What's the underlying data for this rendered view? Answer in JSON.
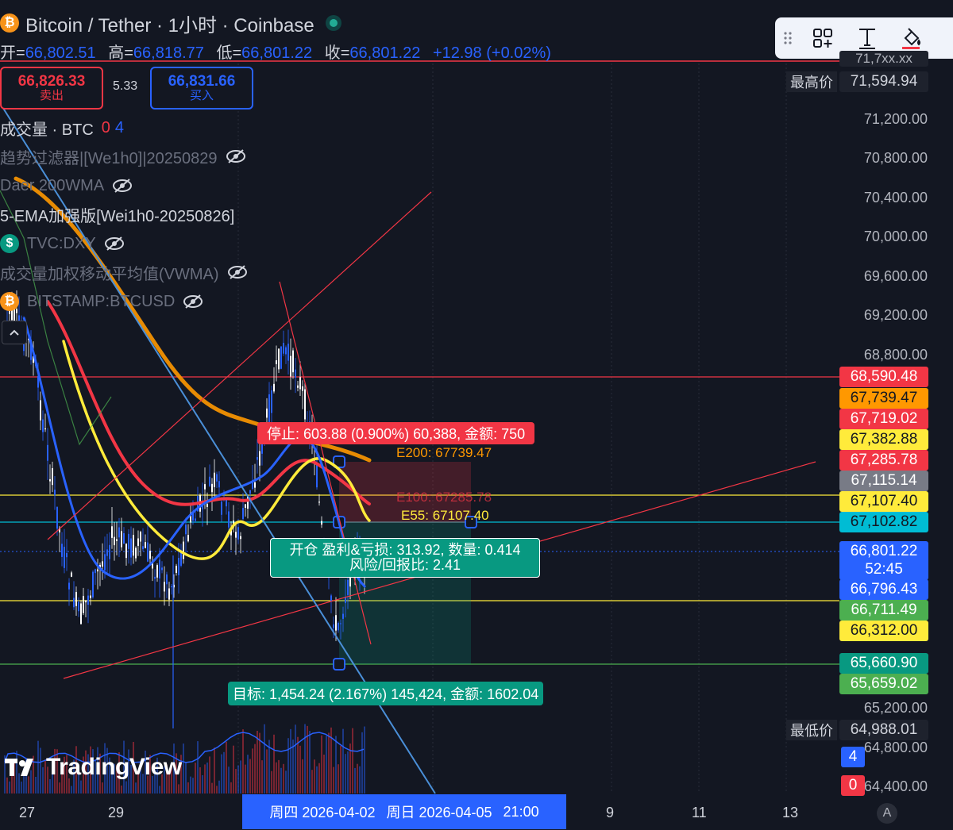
{
  "header": {
    "coin_glyph": "₿",
    "title": "Bitcoin / Tether · 1小时 · Coinbase",
    "ohlc": {
      "open_label": "开=",
      "open": "66,802.51",
      "high_label": "高=",
      "high": "66,818.77",
      "low_label": "低=",
      "low": "66,801.22",
      "close_label": "收=",
      "close": "66,801.22",
      "change": "+12.98 (+0.02%)"
    }
  },
  "trade": {
    "sell_price": "66,826.33",
    "sell_label": "卖出",
    "spread": "5.33",
    "buy_price": "66,831.66",
    "buy_label": "买入"
  },
  "indicators": {
    "volume_label": "成交量 · BTC",
    "volume_v1": "0",
    "volume_v2": "4",
    "trend_filter": "趋势过滤器|[We1h0]|20250829",
    "wma200": "Daer 200WMA",
    "ema5": "5-EMA加强版[Wei1h0-20250826]",
    "dxy": "TVC:DXY",
    "vwma": "成交量加权移动平均值(VWMA)",
    "bitstamp": "BITSTAMP:BTCUSD"
  },
  "price_axis": {
    "ticks": [
      "71,200.00",
      "70,800.00",
      "70,400.00",
      "70,000.00",
      "69,600.00",
      "69,200.00",
      "68,800.00",
      "65,200.00",
      "64,800.00",
      "64,400.00"
    ],
    "high_label": "最高价",
    "high_value": "71,594.94",
    "low_label": "最低价",
    "low_value": "64,988.01",
    "top_partial": "71,7xx.xx"
  },
  "price_labels": [
    {
      "value": "68,590.48",
      "color": "#f23645",
      "text": "#ffffff"
    },
    {
      "value": "67,739.47",
      "color": "#ff9800",
      "text": "#131722"
    },
    {
      "value": "67,719.02",
      "color": "#f23645",
      "text": "#ffffff"
    },
    {
      "value": "67,382.88",
      "color": "#ffeb3b",
      "text": "#131722"
    },
    {
      "value": "67,285.78",
      "color": "#f23645",
      "text": "#ffffff"
    },
    {
      "value": "67,115.14",
      "color": "#787b86",
      "text": "#ffffff"
    },
    {
      "value": "67,107.40",
      "color": "#ffeb3b",
      "text": "#131722"
    },
    {
      "value": "67,102.82",
      "color": "#00bcd4",
      "text": "#131722"
    },
    {
      "value": "66,801.22",
      "color": "#2962ff",
      "text": "#ffffff"
    },
    {
      "value": "52:45",
      "color": "#2962ff",
      "text": "#ffffff"
    },
    {
      "value": "66,796.43",
      "color": "#2962ff",
      "text": "#ffffff"
    },
    {
      "value": "66,711.49",
      "color": "#4caf50",
      "text": "#ffffff"
    },
    {
      "value": "66,312.00",
      "color": "#ffeb3b",
      "text": "#131722"
    },
    {
      "value": "65,660.90",
      "color": "#089981",
      "text": "#ffffff"
    },
    {
      "value": "65,659.02",
      "color": "#4caf50",
      "text": "#ffffff"
    }
  ],
  "volume_badges": [
    "4",
    "0"
  ],
  "position": {
    "stop": "停止: 603.88 (0.900%) 60,388, 金额: 750",
    "open_line1": "开仓 盈利&亏损: 313.92, 数量: 0.414",
    "open_line2": "风险/回报比: 2.41",
    "target": "目标: 1,454.24 (2.167%) 145,424, 金额: 1602.04"
  },
  "ema_labels": {
    "e200": "E200: 67739.47",
    "e100": "E100: 67285.78",
    "e55": "E55: 67107.40"
  },
  "time_axis": {
    "ticks": [
      "27",
      "29",
      "9",
      "11",
      "13"
    ],
    "sel_a": "周四 2026-04-02",
    "sel_b": "周日 2026-04-05",
    "sel_c": "21:00",
    "scale_btn": "A"
  },
  "brand": "TradingView",
  "colors": {
    "background": "#131722",
    "up": "#ffffff",
    "red": "#f23645",
    "green": "#089981",
    "blue": "#2962ff",
    "ema200": "#ff9800",
    "ema100": "#f23645",
    "ema55": "#ffeb3b"
  }
}
